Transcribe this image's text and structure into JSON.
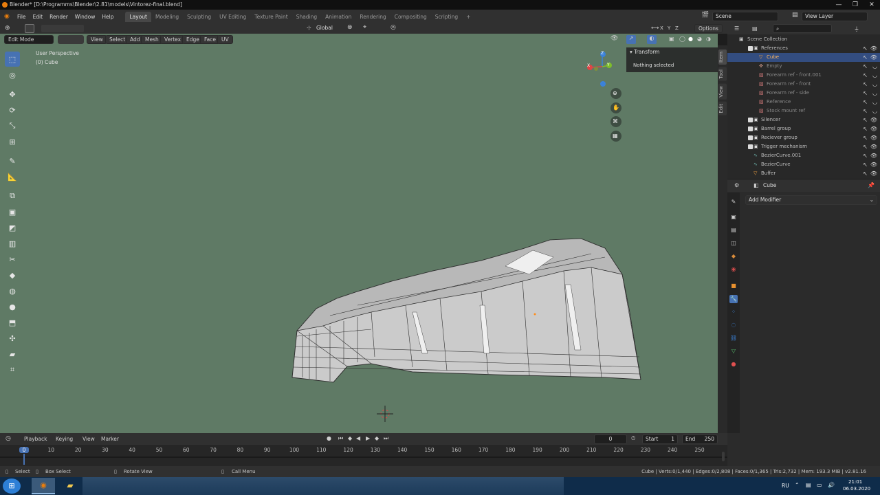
{
  "window": {
    "title": "Blender* [D:\\Programms\\Blender\\2.81\\models\\Vintorez-final.blend]",
    "controls": [
      "—",
      "❐",
      "✕"
    ]
  },
  "menubar": {
    "menus": [
      "File",
      "Edit",
      "Render",
      "Window",
      "Help"
    ],
    "workspaces": [
      "Layout",
      "Modeling",
      "Sculpting",
      "UV Editing",
      "Texture Paint",
      "Shading",
      "Animation",
      "Rendering",
      "Compositing",
      "Scripting"
    ],
    "active_workspace": "Layout",
    "add_tab": "+",
    "scene": "Scene",
    "view_layer": "View Layer"
  },
  "viewport_header": {
    "orientation": "Global",
    "options": "Options",
    "axes": [
      "X",
      "Y",
      "Z"
    ],
    "mode": "Edit Mode",
    "menus": [
      "View",
      "Select",
      "Add",
      "Mesh",
      "Vertex",
      "Edge",
      "Face",
      "UV"
    ]
  },
  "viewport": {
    "view_name": "User Perspective",
    "object_name": "(0) Cube",
    "background_color": "#5f7a65",
    "mesh_color": "#cfcfcf",
    "gizmo": {
      "x": "X",
      "y": "Y",
      "z": "Z"
    }
  },
  "npanel": {
    "section": "Transform",
    "message": "Nothing selected",
    "tabs": [
      "Item",
      "Tool",
      "View",
      "Edit"
    ]
  },
  "outliner": {
    "root": "Scene Collection",
    "items": [
      {
        "name": "References",
        "kind": "collection",
        "indent": 1,
        "checked": true
      },
      {
        "name": "Cube",
        "kind": "mesh",
        "indent": 2,
        "selected": true
      },
      {
        "name": "Empty",
        "kind": "empty",
        "indent": 2,
        "dim": true
      },
      {
        "name": "Forearm ref - front.001",
        "kind": "image",
        "indent": 2,
        "dim": true
      },
      {
        "name": "Forearm ref - front",
        "kind": "image",
        "indent": 2,
        "dim": true
      },
      {
        "name": "Forearm ref - side",
        "kind": "image",
        "indent": 2,
        "dim": true
      },
      {
        "name": "Reference",
        "kind": "image",
        "indent": 2,
        "dim": true
      },
      {
        "name": "Stock mount ref",
        "kind": "image",
        "indent": 2,
        "dim": true
      },
      {
        "name": "Silencer",
        "kind": "collection",
        "indent": 1,
        "checked": true
      },
      {
        "name": "Barrel group",
        "kind": "collection",
        "indent": 1,
        "checked": true
      },
      {
        "name": "Reciever group",
        "kind": "collection",
        "indent": 1,
        "checked": true
      },
      {
        "name": "Trigger mechanism",
        "kind": "collection",
        "indent": 1,
        "checked": true
      },
      {
        "name": "BezierCurve.001",
        "kind": "curve",
        "indent": 1
      },
      {
        "name": "BezierCurve",
        "kind": "curve",
        "indent": 1
      },
      {
        "name": "Buffer",
        "kind": "mesh",
        "indent": 1
      }
    ]
  },
  "properties": {
    "object": "Cube",
    "add_modifier": "Add Modifier"
  },
  "timeline": {
    "menus": [
      "Playback",
      "Keying",
      "View",
      "Marker"
    ],
    "current_frame": "0",
    "start_label": "Start",
    "start": "1",
    "end_label": "End",
    "end": "250",
    "ticks": [
      "0",
      "10",
      "20",
      "30",
      "40",
      "50",
      "60",
      "70",
      "80",
      "90",
      "100",
      "110",
      "120",
      "130",
      "140",
      "150",
      "160",
      "170",
      "180",
      "190",
      "200",
      "210",
      "220",
      "230",
      "240",
      "250"
    ]
  },
  "statusbar": {
    "left": [
      {
        "key": "Select"
      },
      {
        "key": "Box Select"
      },
      {
        "key": "Rotate View"
      },
      {
        "key": "Call Menu"
      }
    ],
    "stats": "Cube | Verts:0/1,440 | Edges:0/2,808 | Faces:0/1,365 | Tris:2,732 | Mem: 193.3 MiB | v2.81.16"
  },
  "taskbar": {
    "lang": "RU",
    "time": "21:01",
    "date": "06.03.2020"
  },
  "colors": {
    "accent": "#4772b3",
    "selection": "#334d80",
    "active_text": "#ffb75e",
    "x_axis": "#e04545",
    "y_axis": "#7fbf2a",
    "z_axis": "#3b82d9"
  }
}
